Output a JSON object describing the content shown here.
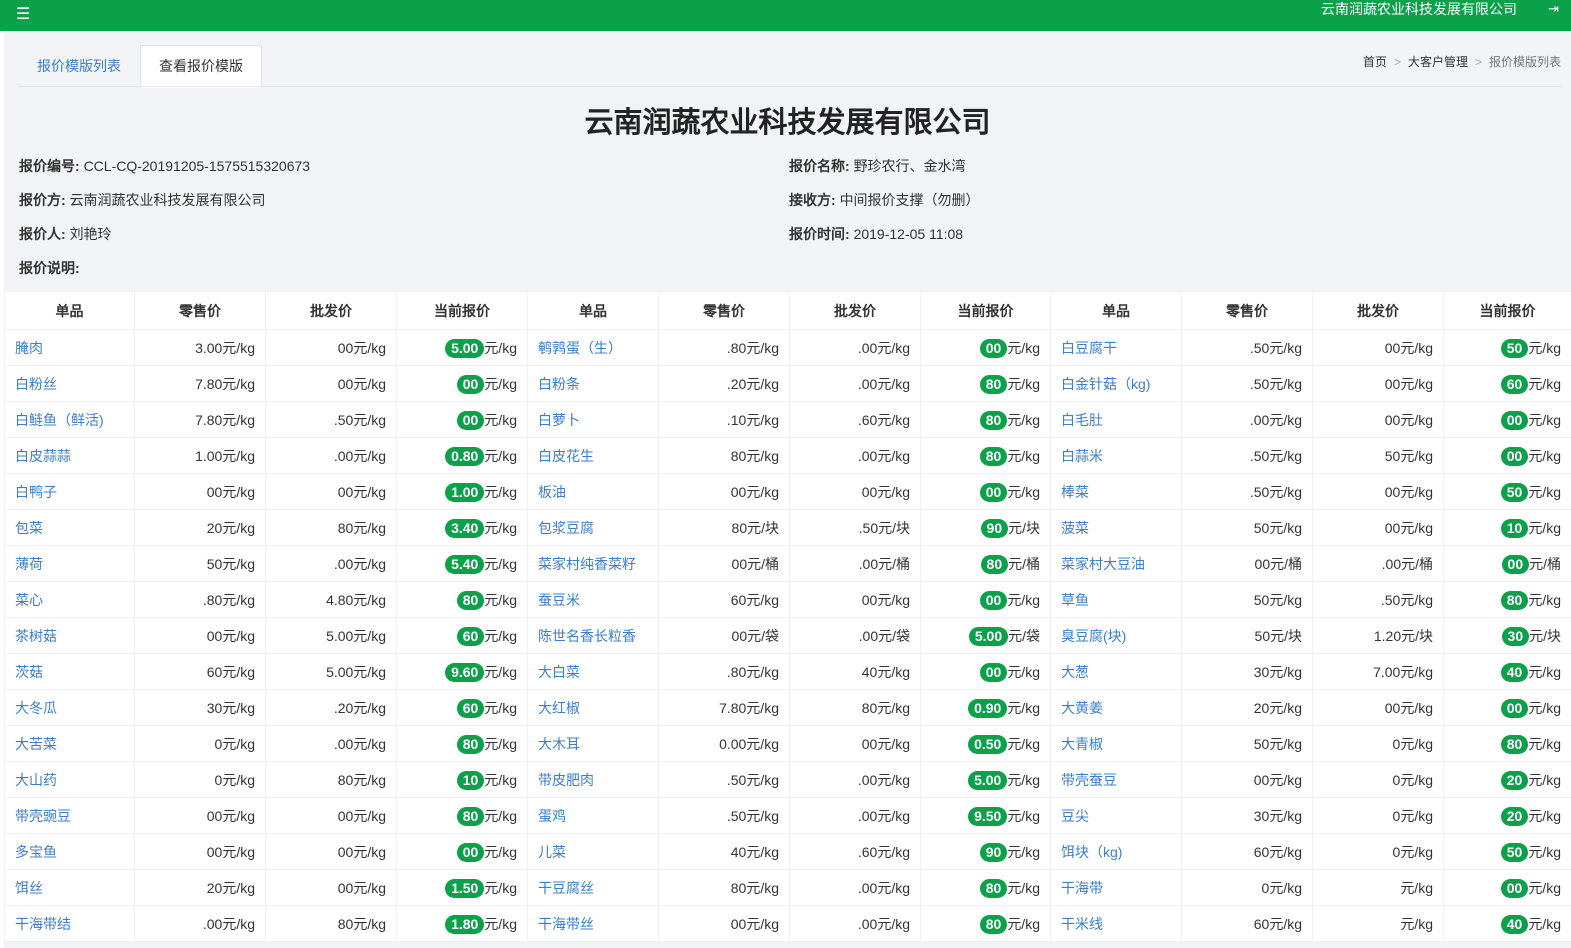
{
  "topbar": {
    "menu_icon": "☰",
    "company": "云南润蔬农业科技发展有限公司",
    "logout_icon": "⇥"
  },
  "tabs": [
    "报价模版列表",
    "查看报价模版"
  ],
  "breadcrumb": [
    "首页",
    "大客户管理",
    "报价模版列表"
  ],
  "title": "云南润蔬农业科技发展有限公司",
  "info": {
    "quote_no_label": "报价编号:",
    "quote_no": "CCL-CQ-20191205-1575515320673",
    "quote_name_label": "报价名称:",
    "quote_name": "野珍农行、金水湾",
    "quoter_label": "报价方:",
    "quoter": "云南润蔬农业科技发展有限公司",
    "receiver_label": "接收方:",
    "receiver": "中间报价支撑（勿删）",
    "person_label": "报价人:",
    "person": "刘艳玲",
    "time_label": "报价时间:",
    "time": "2019-12-05 11:08",
    "desc_label": "报价说明:",
    "desc": ""
  },
  "columns": [
    "单品",
    "零售价",
    "批发价",
    "当前报价",
    "单品",
    "零售价",
    "批发价",
    "当前报价",
    "单品",
    "零售价",
    "批发价",
    "当前报价"
  ],
  "rows": [
    [
      [
        "腌肉",
        "3.00元/kg",
        "00元/kg",
        "5.00",
        "元/kg"
      ],
      [
        "鹌鹑蛋（生）",
        ".80元/kg",
        ".00元/kg",
        "00",
        "元/kg"
      ],
      [
        "白豆腐干",
        ".50元/kg",
        "00元/kg",
        "50",
        "元/kg"
      ]
    ],
    [
      [
        "白粉丝",
        "7.80元/kg",
        "00元/kg",
        "00",
        "元/kg"
      ],
      [
        "白粉条",
        ".20元/kg",
        ".00元/kg",
        "80",
        "元/kg"
      ],
      [
        "白金针菇（kg)",
        ".50元/kg",
        "00元/kg",
        "60",
        "元/kg"
      ]
    ],
    [
      [
        "白鲢鱼（鲜活)",
        "7.80元/kg",
        ".50元/kg",
        "00",
        "元/kg"
      ],
      [
        "白萝卜",
        ".10元/kg",
        ".60元/kg",
        "80",
        "元/kg"
      ],
      [
        "白毛肚",
        ".00元/kg",
        "00元/kg",
        "00",
        "元/kg"
      ]
    ],
    [
      [
        "白皮蒜蒜",
        "1.00元/kg",
        ".00元/kg",
        "0.80",
        "元/kg"
      ],
      [
        "白皮花生",
        "80元/kg",
        ".00元/kg",
        "80",
        "元/kg"
      ],
      [
        "白蒜米",
        ".50元/kg",
        "50元/kg",
        "00",
        "元/kg"
      ]
    ],
    [
      [
        "白鸭子",
        "00元/kg",
        "00元/kg",
        "1.00",
        "元/kg"
      ],
      [
        "板油",
        "00元/kg",
        "00元/kg",
        "00",
        "元/kg"
      ],
      [
        "棒菜",
        ".50元/kg",
        "00元/kg",
        "50",
        "元/kg"
      ]
    ],
    [
      [
        "包菜",
        "20元/kg",
        "80元/kg",
        "3.40",
        "元/kg"
      ],
      [
        "包浆豆腐",
        "80元/块",
        ".50元/块",
        "90",
        "元/块"
      ],
      [
        "菠菜",
        "50元/kg",
        "00元/kg",
        "10",
        "元/kg"
      ]
    ],
    [
      [
        "薄荷",
        "50元/kg",
        ".00元/kg",
        "5.40",
        "元/kg"
      ],
      [
        "菜家村纯香菜籽",
        "00元/桶",
        ".00元/桶",
        "80",
        "元/桶"
      ],
      [
        "菜家村大豆油",
        "00元/桶",
        ".00元/桶",
        "00",
        "元/桶"
      ]
    ],
    [
      [
        "菜心",
        ".80元/kg",
        "4.80元/kg",
        "80",
        "元/kg"
      ],
      [
        "蚕豆米",
        "60元/kg",
        "00元/kg",
        "00",
        "元/kg"
      ],
      [
        "草鱼",
        "50元/kg",
        ".50元/kg",
        "80",
        "元/kg"
      ]
    ],
    [
      [
        "茶树菇",
        "00元/kg",
        "5.00元/kg",
        "60",
        "元/kg"
      ],
      [
        "陈世名香长粒香",
        "00元/袋",
        ".00元/袋",
        "5.00",
        "元/袋"
      ],
      [
        "臭豆腐(块)",
        "50元/块",
        "1.20元/块",
        "30",
        "元/块"
      ]
    ],
    [
      [
        "茨菇",
        "60元/kg",
        "5.00元/kg",
        "9.60",
        "元/kg"
      ],
      [
        "大白菜",
        ".80元/kg",
        "40元/kg",
        "00",
        "元/kg"
      ],
      [
        "大葱",
        "30元/kg",
        "7.00元/kg",
        "40",
        "元/kg"
      ]
    ],
    [
      [
        "大冬瓜",
        "30元/kg",
        ".20元/kg",
        "60",
        "元/kg"
      ],
      [
        "大红椒",
        "7.80元/kg",
        "80元/kg",
        "0.90",
        "元/kg"
      ],
      [
        "大黄姜",
        "20元/kg",
        "00元/kg",
        "00",
        "元/kg"
      ]
    ],
    [
      [
        "大苦菜",
        "0元/kg",
        ".00元/kg",
        "80",
        "元/kg"
      ],
      [
        "大木耳",
        "0.00元/kg",
        "00元/kg",
        "0.50",
        "元/kg"
      ],
      [
        "大青椒",
        "50元/kg",
        "0元/kg",
        "80",
        "元/kg"
      ]
    ],
    [
      [
        "大山药",
        "0元/kg",
        "80元/kg",
        "10",
        "元/kg"
      ],
      [
        "带皮肥肉",
        ".50元/kg",
        ".00元/kg",
        "5.00",
        "元/kg"
      ],
      [
        "带壳蚕豆",
        "00元/kg",
        "0元/kg",
        "20",
        "元/kg"
      ]
    ],
    [
      [
        "带壳豌豆",
        "00元/kg",
        "00元/kg",
        "80",
        "元/kg"
      ],
      [
        "蛋鸡",
        ".50元/kg",
        ".00元/kg",
        "9.50",
        "元/kg"
      ],
      [
        "豆尖",
        "30元/kg",
        "0元/kg",
        "20",
        "元/kg"
      ]
    ],
    [
      [
        "多宝鱼",
        "00元/kg",
        "00元/kg",
        "00",
        "元/kg"
      ],
      [
        "儿菜",
        "40元/kg",
        ".60元/kg",
        "90",
        "元/kg"
      ],
      [
        "饵块（kg)",
        "60元/kg",
        "0元/kg",
        "50",
        "元/kg"
      ]
    ],
    [
      [
        "饵丝",
        "20元/kg",
        "00元/kg",
        "1.50",
        "元/kg"
      ],
      [
        "干豆腐丝",
        "80元/kg",
        ".00元/kg",
        "80",
        "元/kg"
      ],
      [
        "干海带",
        "0元/kg",
        "元/kg",
        "00",
        "元/kg"
      ]
    ],
    [
      [
        "干海带结",
        ".00元/kg",
        "80元/kg",
        "1.80",
        "元/kg"
      ],
      [
        "干海带丝",
        "00元/kg",
        ".00元/kg",
        "80",
        "元/kg"
      ],
      [
        "干米线",
        "60元/kg",
        "元/kg",
        "40",
        "元/kg"
      ]
    ]
  ],
  "colors": {
    "brand": "#0aa14a",
    "link": "#3c7ec8"
  }
}
